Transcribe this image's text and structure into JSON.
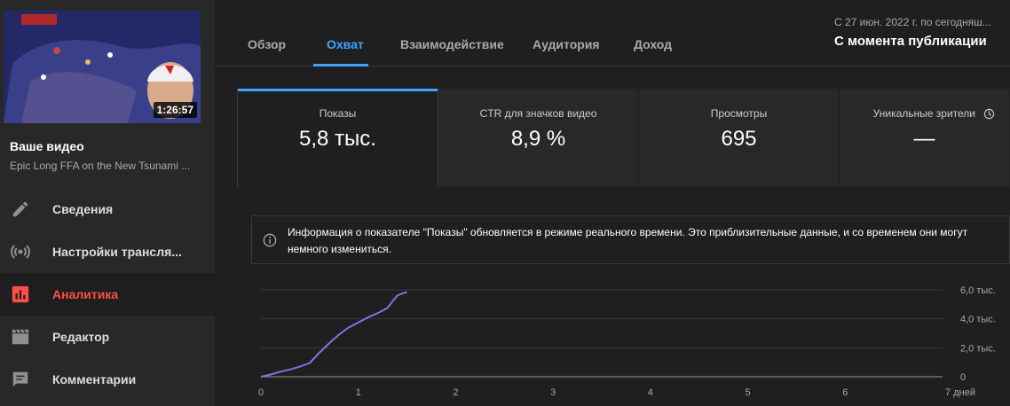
{
  "sidebar": {
    "duration": "1:26:57",
    "your_video": "Ваше видео",
    "video_title": "Epic Long FFA on the New Tsunami ...",
    "items": [
      {
        "label": "Сведения",
        "icon": "pencil-icon"
      },
      {
        "label": "Настройки трансля...",
        "icon": "broadcast-icon"
      },
      {
        "label": "Аналитика",
        "icon": "analytics-icon",
        "active": true
      },
      {
        "label": "Редактор",
        "icon": "clapperboard-icon"
      },
      {
        "label": "Комментарии",
        "icon": "comment-icon"
      }
    ]
  },
  "tabs": [
    {
      "label": "Обзор"
    },
    {
      "label": "Охват",
      "active": true
    },
    {
      "label": "Взаимодействие"
    },
    {
      "label": "Аудитория"
    },
    {
      "label": "Доход"
    }
  ],
  "date": {
    "range": "С 27 июн. 2022 г. по сегодняш...",
    "period": "С момента публикации"
  },
  "metrics": [
    {
      "label": "Показы",
      "value": "5,8 тыс."
    },
    {
      "label": "CTR для значков видео",
      "value": "8,9 %"
    },
    {
      "label": "Просмотры",
      "value": "695"
    },
    {
      "label": "Уникальные зрители",
      "value": "—"
    }
  ],
  "info": {
    "text": "Информация о показателе \"Показы\" обновляется в режиме реального времени. Это приблизительные данные, и со временем они могут немного измениться."
  },
  "colors": {
    "accent": "#3ea6ff",
    "active_nav": "#ff4e45",
    "line": "#7b74e8"
  },
  "chart_data": {
    "type": "line",
    "x_ticks": [
      "0",
      "1",
      "2",
      "3",
      "4",
      "5",
      "6",
      "7 дней"
    ],
    "y_ticks": [
      "0",
      "2,0 тыс.",
      "4,0 тыс.",
      "6,0 тыс."
    ],
    "xlim": [
      0,
      7
    ],
    "ylim": [
      0,
      6000
    ],
    "series": [
      {
        "x": [
          0,
          0.1,
          0.2,
          0.3,
          0.4,
          0.5,
          0.6,
          0.7,
          0.8,
          0.9,
          1.0,
          1.1,
          1.2,
          1.3,
          1.35,
          1.4,
          1.45,
          1.5
        ],
        "y": [
          0,
          150,
          350,
          500,
          700,
          950,
          1650,
          2300,
          2900,
          3400,
          3750,
          4100,
          4400,
          4750,
          5200,
          5600,
          5750,
          5850
        ]
      }
    ]
  }
}
